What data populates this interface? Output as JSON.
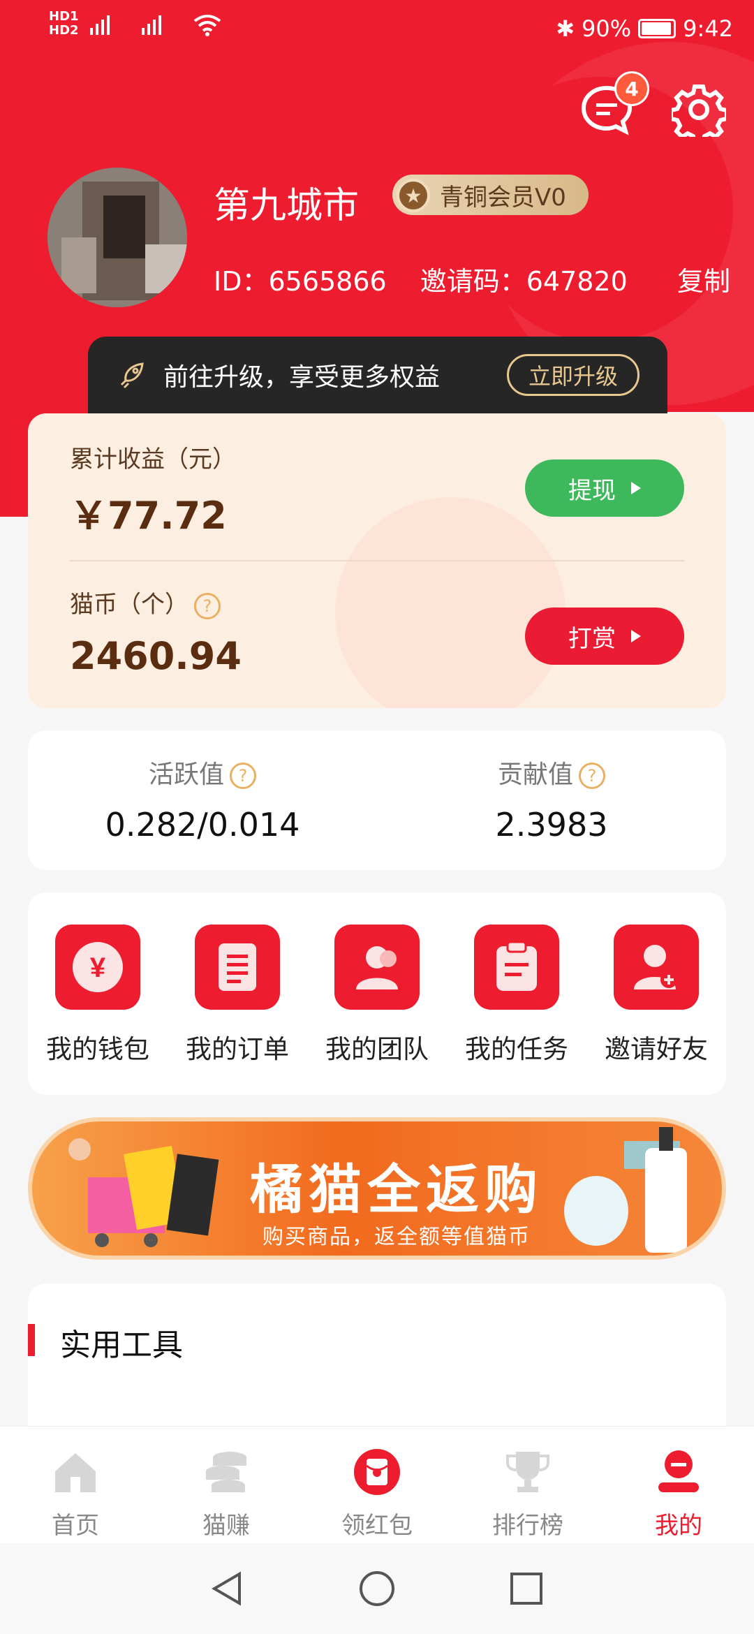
{
  "status": {
    "network1": "HD1 4G",
    "network2": "HD2 4G",
    "battery": "90%",
    "time": "9:42"
  },
  "header": {
    "message_count": "4",
    "username": "第九城市",
    "member_level": "青铜会员V0",
    "id_text": "ID：6565866",
    "invite_text": "邀请码：647820",
    "copy_label": "复制"
  },
  "upgrade": {
    "text": "前往升级，享受更多权益",
    "button": "立即升级"
  },
  "earnings": {
    "total_label": "累计收益（元）",
    "total_value": "￥77.72",
    "withdraw_label": "提现",
    "coin_label": "猫币（个）",
    "coin_value": "2460.94",
    "tip_label": "打赏"
  },
  "stats": {
    "active_label": "活跃值",
    "active_value": "0.282/0.014",
    "contrib_label": "贡献值",
    "contrib_value": "2.3983"
  },
  "shortcuts": [
    {
      "label": "我的钱包",
      "icon": "wallet-icon"
    },
    {
      "label": "我的订单",
      "icon": "order-icon"
    },
    {
      "label": "我的团队",
      "icon": "team-icon"
    },
    {
      "label": "我的任务",
      "icon": "task-icon"
    },
    {
      "label": "邀请好友",
      "icon": "invite-icon"
    }
  ],
  "banner": {
    "title": "橘猫全返购",
    "subtitle": "购买商品，返全额等值猫币"
  },
  "tools": {
    "title": "实用工具"
  },
  "nav": [
    {
      "label": "首页",
      "icon": "home-icon"
    },
    {
      "label": "猫赚",
      "icon": "coins-icon"
    },
    {
      "label": "领红包",
      "icon": "red-packet-icon"
    },
    {
      "label": "排行榜",
      "icon": "trophy-icon"
    },
    {
      "label": "我的",
      "icon": "profile-icon"
    }
  ],
  "colors": {
    "primary": "#ee1c2f",
    "green": "#3db85a",
    "card_bg": "#fdeee2"
  }
}
